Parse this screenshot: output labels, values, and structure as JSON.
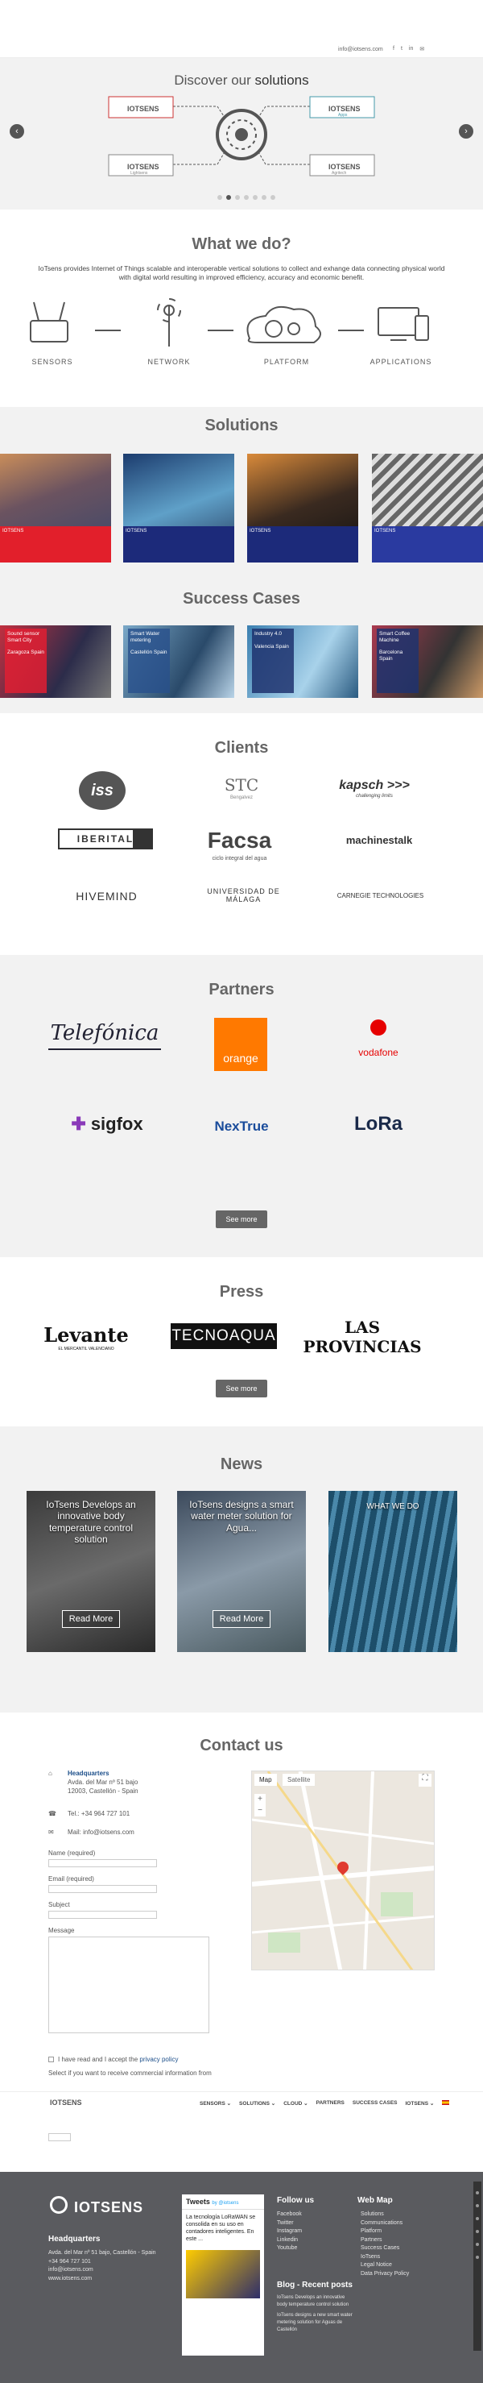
{
  "header": {
    "email": "info@iotsens.com",
    "social": [
      "f",
      "t",
      "in",
      "✉"
    ]
  },
  "hero": {
    "title_prefix": "Discover our",
    "title_word": "solutions",
    "logos": [
      "IOTSENS",
      "IOTSENS",
      "IOTSENS",
      "IOTSENS"
    ],
    "logo_subs": [
      "",
      "Apps",
      "Lightsens",
      "Agritech"
    ],
    "prev": "‹",
    "next": "›",
    "slides": 7,
    "active_slide": 1
  },
  "what": {
    "title": "What we do?",
    "text": "IoTsens provides Internet of Things scalable and interoperable vertical solutions to collect and exhange data connecting physical world with digital world resulting in improved efficiency, accuracy and economic benefit.",
    "steps": [
      "SENSORS",
      "NETWORK",
      "PLATFORM",
      "APPLICATIONS"
    ]
  },
  "solutions": {
    "title": "Solutions",
    "tile_logo": "IOTSENS",
    "colors": [
      "#e21f2b",
      "#1c2a7a",
      "#1c2a7a",
      "#1c2a7a"
    ]
  },
  "success": {
    "title": "Success Cases",
    "cases": [
      {
        "name": "Sound sensor Smart City",
        "place": "Zaragoza Spain"
      },
      {
        "name": "Smart Water metering",
        "place": "Castellón Spain"
      },
      {
        "name": "Industry 4.0",
        "place": "Valencia Spain"
      },
      {
        "name": "Smart Coffee Machine",
        "place": "Barcelona Spain"
      }
    ]
  },
  "clients": {
    "title": "Clients",
    "logos": [
      "iss",
      "STC",
      "kapsch >>>",
      "IBERITAL",
      "Facsa",
      "machinestalk",
      "HIVEMIND",
      "UNIVERSIDAD DE MÁLAGA",
      "CARNEGIE TECHNOLOGIES"
    ],
    "subs": [
      "",
      "Bengalvez",
      "challenging limits",
      "",
      "ciclo integral del agua",
      "",
      "",
      "uma",
      ""
    ]
  },
  "partners": {
    "title": "Partners",
    "logos": [
      "Telefónica",
      "orange",
      "vodafone",
      "sigfox",
      "NexTrue",
      "LoRa"
    ],
    "see_more": "See more"
  },
  "press": {
    "title": "Press",
    "logos": [
      "Levante",
      "TECNOAQUA",
      "LAS PROVINCIAS"
    ],
    "levante_sub": "EL MERCANTIL VALENCIANO",
    "see_more": "See more"
  },
  "news": {
    "title": "News",
    "items": [
      {
        "title": "IoTsens Develops an innovative body temperature control solution",
        "button": "Read More"
      },
      {
        "title": "IoTsens designs a smart water meter solution for Agua...",
        "button": "Read More"
      },
      {
        "title": "WHAT WE DO",
        "button": ""
      }
    ]
  },
  "contact": {
    "title": "Contact us",
    "hq_label": "Headquarters",
    "address": "Avda. del Mar nº 51 bajo 12003, Castellón - Spain",
    "tel": "Tel.: +34 964 727 101",
    "mail": "Mail: info@iotsens.com",
    "name_label": "Name (required)",
    "email_label": "Email (required)",
    "subject_label": "Subject",
    "message_label": "Message",
    "privacy": "I have read and I accept the",
    "privacy_link": "privacy policy",
    "commercial": "Select if you want to receive commercial information from",
    "map_tab": "Map",
    "sat_tab": "Satellite",
    "nav": [
      "SENSORS ⌄",
      "SOLUTIONS ⌄",
      "CLOUD ⌄",
      "PARTNERS",
      "SUCCESS CASES",
      "IOTSENS ⌄"
    ]
  },
  "footer": {
    "logo": "IOTSENS",
    "hq": "Headquarters",
    "address": "Avda. del Mar nº 51 bajo, Castellón - Spain",
    "phone": "+34 964 727 101",
    "email": "info@iotsens.com",
    "web": "www.iotsens.com",
    "tweets_title": "Tweets",
    "tweets_by": "by @iotsens",
    "tweet_text": "La tecnología LoRaWAN se consolida en su uso en contadores inteligentes. En este ...",
    "follow": "Follow us",
    "follow_items": [
      "Facebook",
      "Twitter",
      "Instagram",
      "Linkedin",
      "Youtube"
    ],
    "blog": "Blog - Recent posts",
    "blog_items": [
      "IoTsens Develops an innovative body temperature control solution",
      "IoTsens designs a new smart water metering solution for Aguas de Castellón"
    ],
    "webmap": "Web Map",
    "webmap_items": [
      "Solutions",
      "Communications",
      "Platform",
      "Partners",
      "Success Cases",
      "IoTsens",
      "Legal Notice",
      "Data Privacy Policy"
    ]
  }
}
